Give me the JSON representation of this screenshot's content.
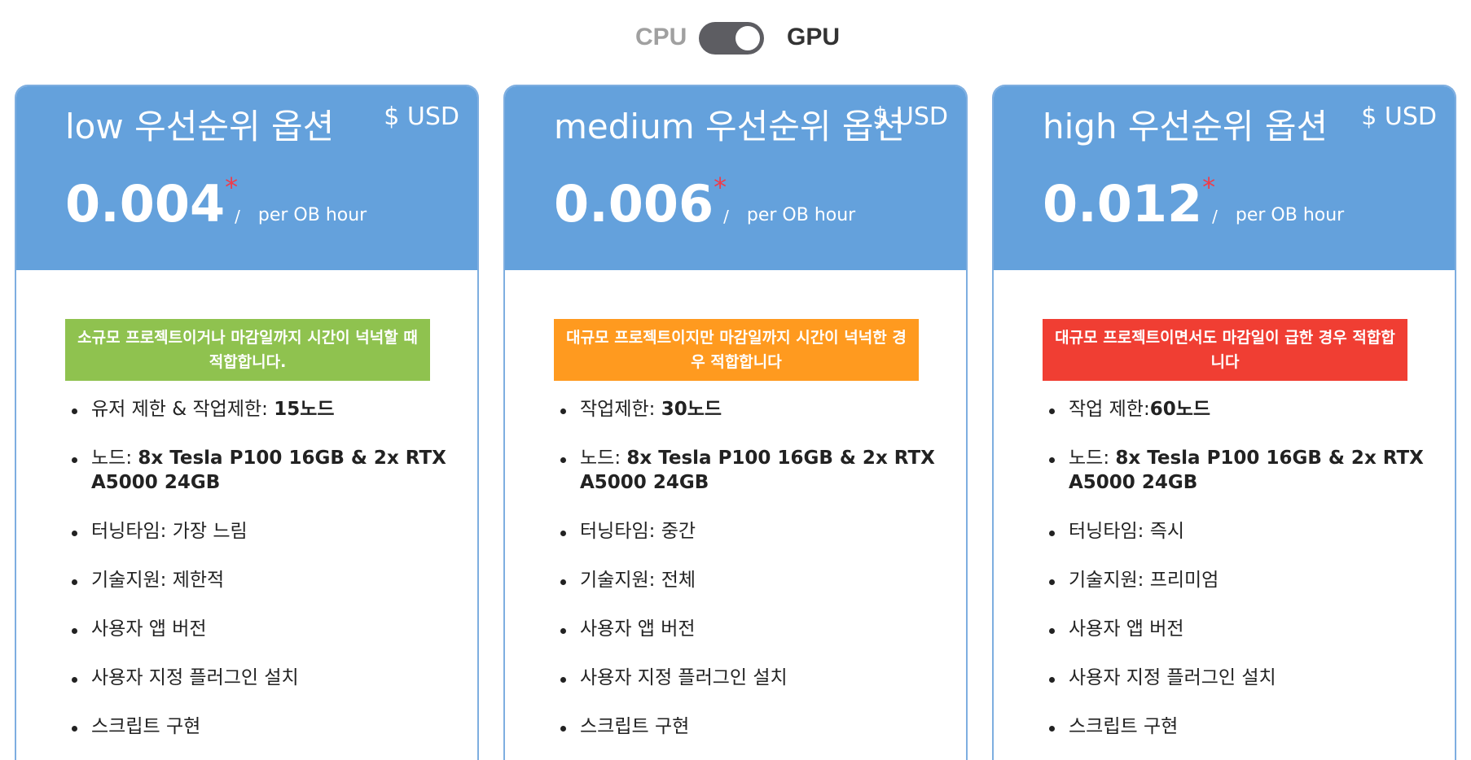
{
  "toggle": {
    "left_label": "CPU",
    "right_label": "GPU",
    "state": "GPU"
  },
  "colors": {
    "header": "#64a1dc",
    "asterisk": "#f03c4a",
    "tag_low": "#8fc24f",
    "tag_medium": "#ff9a1f",
    "tag_high": "#f03e33"
  },
  "plans": [
    {
      "title": "low 우선순위 옵션",
      "currency": "$ USD",
      "price": "0.004",
      "asterisk": "*",
      "slash": "/",
      "per": "per OB hour",
      "tag": "소규모 프로젝트이거나 마감일까지 시간이 넉넉할 때 적합합니다.",
      "features": [
        {
          "label": "유저 제한 & 작업제한: ",
          "value": "15노드"
        },
        {
          "label": "노드: ",
          "value": "8x Tesla P100 16GB & 2x RTX A5000 24GB"
        },
        {
          "label": "터닝타임: 가장 느림",
          "value": ""
        },
        {
          "label": "기술지원: 제한적",
          "value": ""
        },
        {
          "label": "사용자 앱 버전",
          "value": ""
        },
        {
          "label": "사용자 지정 플러그인 설치",
          "value": ""
        },
        {
          "label": "스크립트 구현",
          "value": ""
        }
      ]
    },
    {
      "title": "medium 우선순위 옵션",
      "currency": "$ USD",
      "price": "0.006",
      "asterisk": "*",
      "slash": "/",
      "per": "per OB hour",
      "tag": "대규모 프로젝트이지만 마감일까지 시간이 넉넉한 경우 적합합니다",
      "features": [
        {
          "label": "작업제한: ",
          "value": "30노드"
        },
        {
          "label": "노드: ",
          "value": "8x Tesla P100 16GB & 2x RTX A5000 24GB"
        },
        {
          "label": "터닝타임: 중간",
          "value": ""
        },
        {
          "label": "기술지원: 전체",
          "value": ""
        },
        {
          "label": "사용자 앱 버전",
          "value": ""
        },
        {
          "label": "사용자 지정 플러그인 설치",
          "value": ""
        },
        {
          "label": "스크립트 구현",
          "value": ""
        }
      ]
    },
    {
      "title": "high 우선순위 옵션",
      "currency": "$ USD",
      "price": "0.012",
      "asterisk": "*",
      "slash": "/",
      "per": "per OB hour",
      "tag": "대규모 프로젝트이면서도 마감일이 급한 경우 적합합니다",
      "features": [
        {
          "label": "작업 제한:",
          "value": "60노드"
        },
        {
          "label": "노드: ",
          "value": "8x Tesla P100 16GB & 2x RTX A5000 24GB"
        },
        {
          "label": "터닝타임: 즉시",
          "value": ""
        },
        {
          "label": "기술지원: 프리미엄",
          "value": ""
        },
        {
          "label": "사용자 앱 버전",
          "value": ""
        },
        {
          "label": "사용자 지정 플러그인 설치",
          "value": ""
        },
        {
          "label": "스크립트 구현",
          "value": ""
        }
      ]
    }
  ]
}
